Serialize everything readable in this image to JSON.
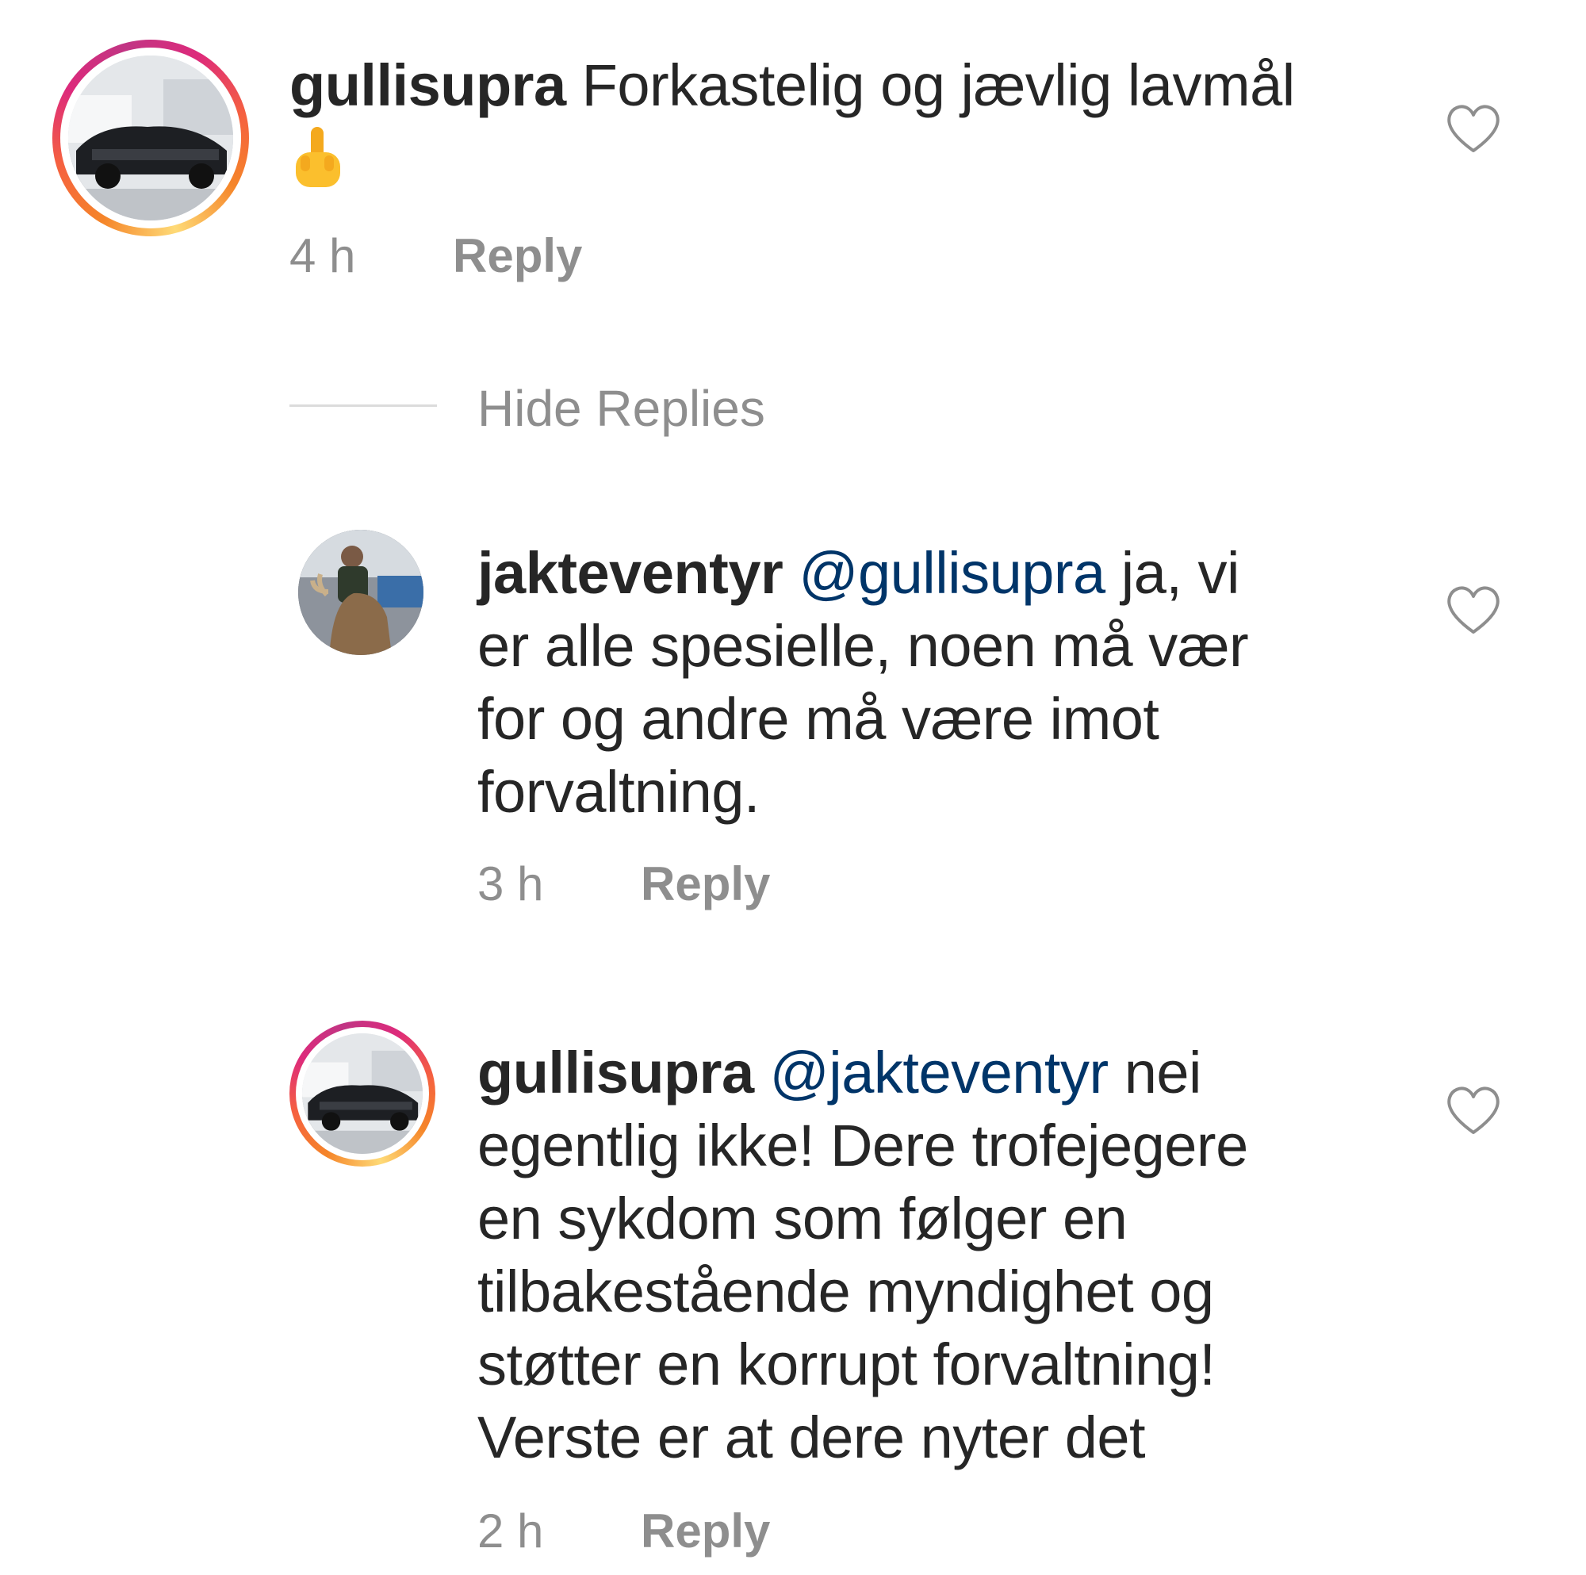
{
  "comments": [
    {
      "username": "gullisupra",
      "mention": "",
      "text": "Forkastelig og jævlig lavmål",
      "emoji": "🖕",
      "time": "4 h",
      "reply_label": "Reply",
      "avatar_has_story_ring": true,
      "avatar": "car-photo"
    },
    {
      "username": "jakteventyr",
      "mention": "@gullisupra",
      "text_line1": "ja, vi",
      "text_line2": "er alle spesielle, noen må vær",
      "text_line3": "for og andre må være imot",
      "text_line4": "forvaltning.",
      "time": "3 h",
      "reply_label": "Reply",
      "avatar_has_story_ring": false,
      "avatar": "hunter-with-moose-photo"
    },
    {
      "username": "gullisupra",
      "mention": "@jakteventyr",
      "text_line1": "nei",
      "text_line2": "egentlig ikke! Dere trofejegere",
      "text_line3": "en sykdom som følger en",
      "text_line4": "tilbakestående myndighet og",
      "text_line5": "støtter en korrupt forvaltning!",
      "text_line6": "Verste er at dere nyter det",
      "time": "2 h",
      "reply_label": "Reply",
      "avatar_has_story_ring": true,
      "avatar": "car-photo"
    }
  ],
  "thread": {
    "hide_replies_label": "Hide Replies"
  },
  "icons": {
    "like": "heart-outline-icon"
  },
  "colors": {
    "text": "#262626",
    "muted": "#8e8e8e",
    "mention": "#003569",
    "divider": "#dbdbdb"
  }
}
